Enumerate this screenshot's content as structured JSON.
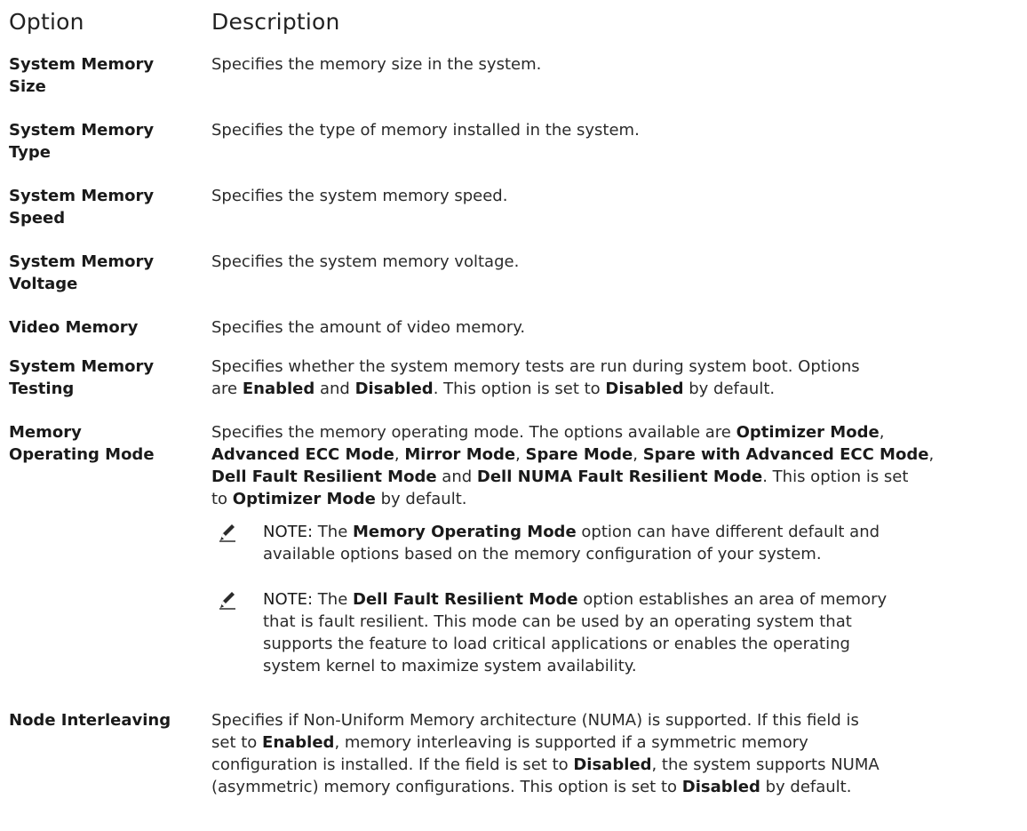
{
  "header": {
    "option": "Option",
    "description": "Description"
  },
  "rows": [
    {
      "option": "System Memory\nSize",
      "description": "Specifies the memory size in the system."
    },
    {
      "option": "System Memory\nType",
      "description": "Specifies the type of memory installed in the system."
    },
    {
      "option": "System Memory\nSpeed",
      "description": "Specifies the system memory speed."
    },
    {
      "option": "System Memory\nVoltage",
      "description": "Specifies the system memory voltage."
    },
    {
      "option": "Video Memory",
      "description": "Specifies the amount of video memory."
    },
    {
      "option": "System Memory\nTesting",
      "description_lines": [
        "Specifies whether the system memory tests are run during system boot. Options",
        {
          "parts": [
            "are ",
            "Enabled",
            " and ",
            "Disabled",
            ". This option is set to ",
            "Disabled",
            " by default."
          ]
        }
      ]
    },
    {
      "option": "Memory\nOperating Mode",
      "description_lines": [
        {
          "parts": [
            "Specifies the memory operating mode. The options available are ",
            "Optimizer Mode",
            ","
          ]
        },
        {
          "parts": [
            "",
            "Advanced ECC Mode",
            ", ",
            "Mirror Mode",
            ", ",
            "Spare Mode",
            ", ",
            "Spare with Advanced ECC Mode",
            ","
          ]
        },
        {
          "parts": [
            "",
            "Dell Fault Resilient Mode",
            " and ",
            "Dell NUMA Fault Resilient Mode",
            ". This option is set"
          ]
        },
        {
          "parts": [
            "to ",
            "Optimizer Mode",
            " by default."
          ]
        }
      ],
      "notes": [
        {
          "label": "NOTE:",
          "lines": [
            {
              "parts": [
                " The ",
                "Memory Operating Mode",
                " option can have different default and"
              ]
            },
            {
              "parts": [
                "available options based on the memory configuration of your system."
              ]
            }
          ]
        },
        {
          "label": "NOTE:",
          "lines": [
            {
              "parts": [
                " The ",
                "Dell Fault Resilient Mode",
                " option establishes an area of memory"
              ]
            },
            {
              "parts": [
                "that is fault resilient. This mode can be used by an operating system that"
              ]
            },
            {
              "parts": [
                "supports the feature to load critical applications or enables the operating"
              ]
            },
            {
              "parts": [
                "system kernel to maximize system availability."
              ]
            }
          ]
        }
      ]
    },
    {
      "option": "Node Interleaving",
      "description_lines": [
        "Specifies if Non-Uniform Memory architecture (NUMA) is supported. If this field is",
        {
          "parts": [
            "set to ",
            "Enabled",
            ", memory interleaving is supported if a symmetric memory"
          ]
        },
        {
          "parts": [
            "configuration is installed. If the field is set to ",
            "Disabled",
            ", the system supports NUMA"
          ]
        },
        {
          "parts": [
            "(asymmetric) memory configurations. This option is set to ",
            "Disabled",
            " by default."
          ]
        }
      ]
    }
  ],
  "icons": {
    "note": "pencil-note-icon"
  },
  "colors": {
    "text": "#222222",
    "icon": "#2b2b2b"
  }
}
